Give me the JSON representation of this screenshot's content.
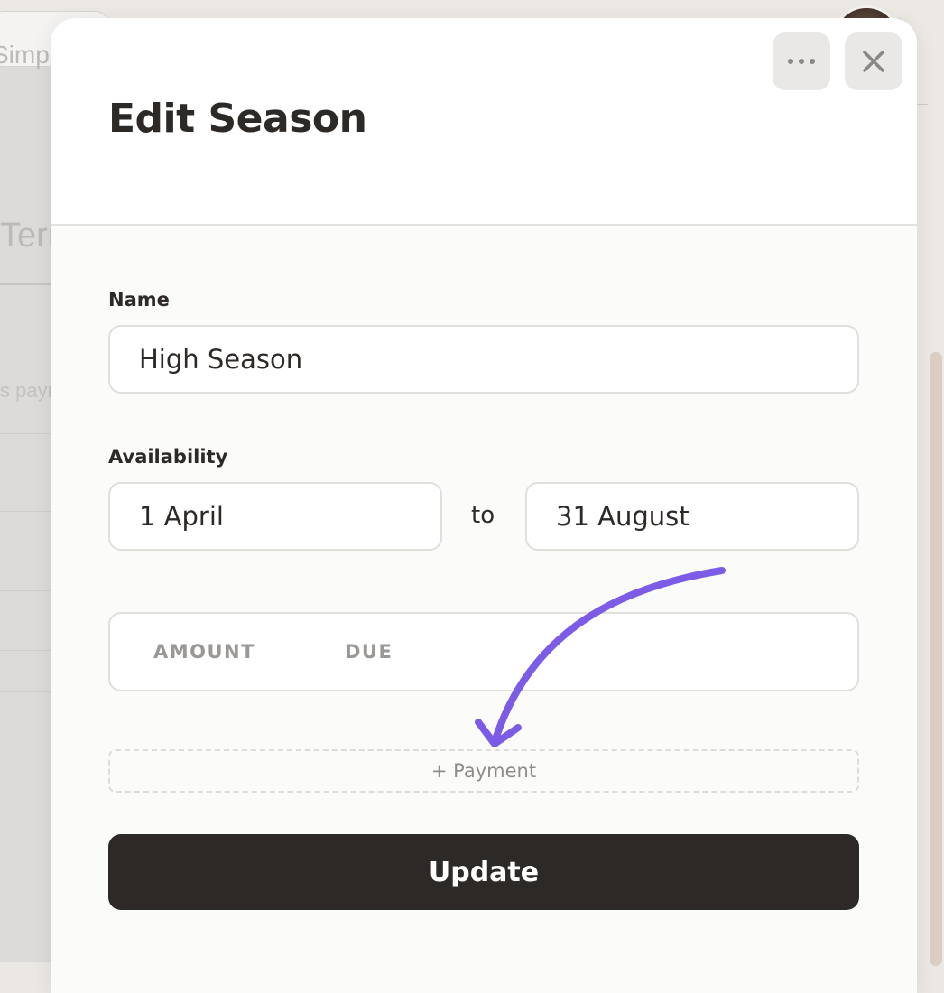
{
  "background": {
    "title_fragment": "Simple",
    "tab_fragment": "Term",
    "text_fragment": "s payr"
  },
  "modal": {
    "title": "Edit Season",
    "more_icon": "ellipsis-icon",
    "close_icon": "close-icon"
  },
  "form": {
    "name_label": "Name",
    "name_value": "High Season",
    "availability_label": "Availability",
    "from_value": "1 April",
    "to_label": "to",
    "to_value": "31 August"
  },
  "payments": {
    "columns": [
      "AMOUNT",
      "DUE"
    ],
    "add_label": "+ Payment"
  },
  "actions": {
    "update_label": "Update"
  },
  "colors": {
    "accent_arrow": "#7c5ce6",
    "primary_button": "#2d2926",
    "text": "#2d2926"
  }
}
